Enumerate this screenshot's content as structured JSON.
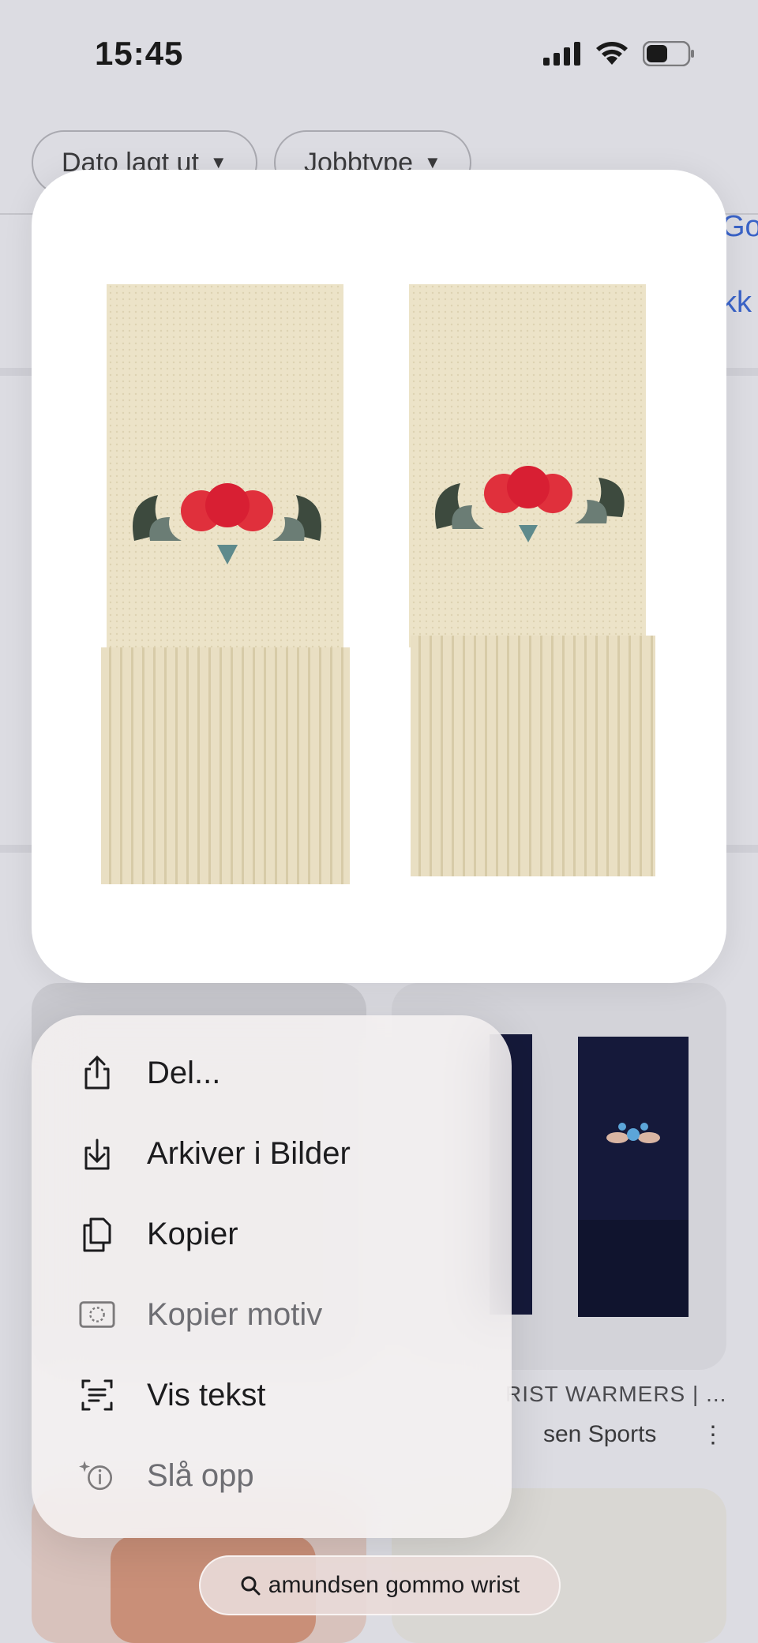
{
  "status_bar": {
    "time": "15:45"
  },
  "filters": [
    {
      "label": "Dato lagt ut"
    },
    {
      "label": "Jobbtype"
    }
  ],
  "background_links": {
    "link1": "Go",
    "link2": "kk"
  },
  "background_result": {
    "title": "RIST WARMERS | ...",
    "source": "sen Sports"
  },
  "context_menu": {
    "items": [
      {
        "label": "Del...",
        "icon": "share-icon",
        "enabled": true
      },
      {
        "label": "Arkiver i Bilder",
        "icon": "save-to-photos-icon",
        "enabled": true
      },
      {
        "label": "Kopier",
        "icon": "copy-icon",
        "enabled": true
      },
      {
        "label": "Kopier motiv",
        "icon": "copy-subject-icon",
        "enabled": false
      },
      {
        "label": "Vis tekst",
        "icon": "show-text-icon",
        "enabled": true
      },
      {
        "label": "Slå opp",
        "icon": "look-up-icon",
        "enabled": false
      }
    ]
  },
  "search_pill": {
    "query": "amundsen gommo wrist"
  },
  "colors": {
    "knit": "#ece2c6",
    "rose_red": "#e0303c",
    "leaf_dark": "#3d4a3e",
    "leaf_grey": "#6b7d75",
    "navy": "#15193a",
    "link_blue": "#3a63c7"
  }
}
